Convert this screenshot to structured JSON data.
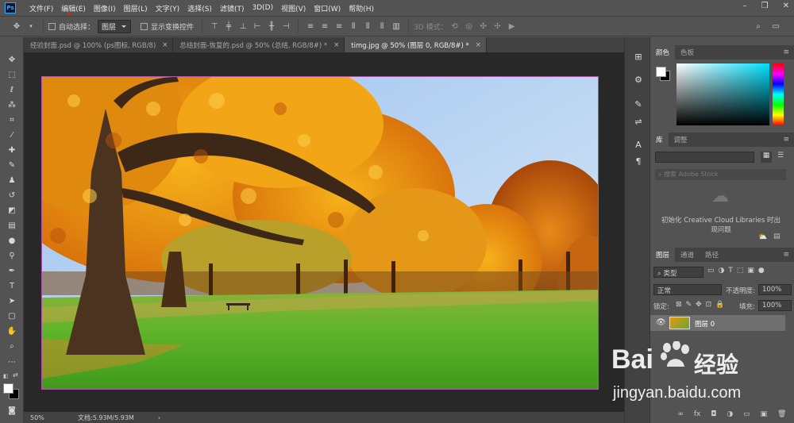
{
  "app": {
    "logo": "Ps"
  },
  "menu": [
    "文件(F)",
    "编辑(E)",
    "图像(I)",
    "图层(L)",
    "文字(Y)",
    "选择(S)",
    "滤镜(T)",
    "3D(D)",
    "视图(V)",
    "窗口(W)",
    "帮助(H)"
  ],
  "window_controls": {
    "minimize": "–",
    "restore": "❐",
    "close": "✕"
  },
  "options": {
    "auto_select_label": "自动选择：",
    "auto_select_value": "图层",
    "show_transform_label": "显示变换控件",
    "mode_3d_label": "3D 模式："
  },
  "tabs": [
    {
      "title": "经验封面.psd @ 100% (ps图标, RGB/8)",
      "close": "×",
      "active": false
    },
    {
      "title": "总结封面-恢复的.psd @ 50% (总结, RGB/8#) *",
      "close": "×",
      "active": false
    },
    {
      "title": "timg.jpg @ 50% (图层 0, RGB/8#) *",
      "close": "×",
      "active": true
    }
  ],
  "status": {
    "zoom": "50%",
    "doc_info": "文档:5.93M/5.93M",
    "arrow": "›"
  },
  "panels": {
    "color_tabs": [
      "颜色",
      "色板"
    ],
    "library_tabs": [
      "库",
      "调整"
    ],
    "library_search_placeholder": "搜索 Adobe Stock",
    "library_message": "初始化 Creative Cloud Libraries 时出现问题",
    "layers_tabs": [
      "图层",
      "通道",
      "路径"
    ],
    "kind_filter": "类型",
    "blend_mode": "正常",
    "opacity_label": "不透明度:",
    "opacity_value": "100%",
    "lock_label": "锁定:",
    "fill_label": "填充:",
    "fill_value": "100%",
    "layer_name": "图层 0",
    "layer_footer_icons": [
      "∞",
      "fx",
      "◘",
      "◑",
      "▭",
      "▣",
      "🗑"
    ]
  },
  "watermark": {
    "brand": "Bai",
    "brand2": "经验",
    "url": "jingyan.baidu.com"
  },
  "colors": {
    "accent": "#31a8ff",
    "foreground_swatch": "#ffffff",
    "background_swatch": "#000000"
  }
}
